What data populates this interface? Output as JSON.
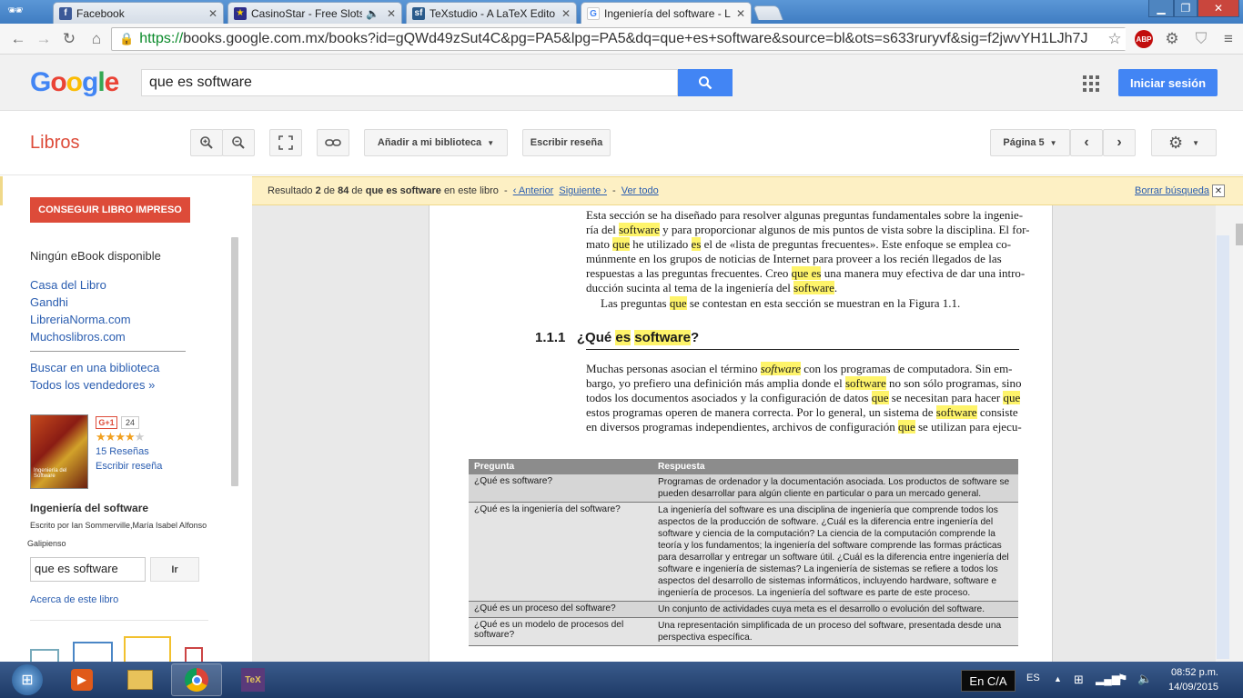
{
  "browser": {
    "tabs": [
      {
        "title": "Facebook",
        "favicon": "facebook-icon",
        "color": "#3b5998"
      },
      {
        "title": "CasinoStar - Free Slots",
        "favicon": "casino-icon",
        "color": "#2d2d8a"
      },
      {
        "title": "TeXstudio - A LaTeX Edito",
        "favicon": "texstudio-icon",
        "color": "#2a5a8a"
      },
      {
        "title": "Ingeniería del software - L",
        "favicon": "google-icon",
        "color": "#4285f4"
      }
    ],
    "url_https": "https://",
    "url_rest": "books.google.com.mx/books?id=gQWd49zSut4C&pg=PA5&lpg=PA5&dq=que+es+software&source=bl&ots=s633ruryvf&sig=f2jwvYH1LJh7J",
    "extension_abp": "ABP"
  },
  "google": {
    "logo": "Google",
    "query": "que es software",
    "signin": "Iniciar sesión"
  },
  "books_bar": {
    "section": "Libros",
    "add_library": "Añadir a mi biblioteca",
    "write_review": "Escribir reseña",
    "page": "Página 5"
  },
  "sidebar": {
    "buy_print": "CONSEGUIR LIBRO IMPRESO",
    "no_ebook": "Ningún eBook disponible",
    "stores": [
      "Casa del Libro",
      "Gandhi",
      "LibreriaNorma.com",
      "Muchoslibros.com"
    ],
    "find_library": "Buscar en una biblioteca",
    "all_sellers": "Todos los vendedores »",
    "gplus": "G+1",
    "gplus_count": "24",
    "rating": 4,
    "reviews": "15 Reseñas",
    "write_review": "Escribir reseña",
    "cover_text": "Ingeniería del Software",
    "book_title": "Ingeniería del software",
    "authors_line1": "Escrito por Ian Sommerville,María Isabel Alfonso",
    "authors_line2": "Galipienso",
    "search_value": "que es software",
    "go": "Ir",
    "about": "Acerca de este libro"
  },
  "result_bar": {
    "prefix": "Resultado",
    "num": "2",
    "of": "de",
    "total": "84",
    "de": "de",
    "query": "que es software",
    "suffix": "en este libro",
    "prev": "‹ Anterior",
    "next": "Siguiente ›",
    "all": "Ver todo",
    "clear": "Borrar búsqueda"
  },
  "page": {
    "section_num": "1.1.1",
    "section_title_pre": "¿Qué",
    "section_title_es": "es",
    "section_title_sw": "software",
    "section_title_end": "?",
    "table_head": [
      "Pregunta",
      "Respuesta"
    ],
    "table_rows": [
      {
        "q": "¿Qué es software?",
        "a": "Programas de ordenador y la documentación asociada. Los productos de software se pueden desarrollar para algún cliente en particular o para un mercado general."
      },
      {
        "q": "¿Qué es la ingeniería del software?",
        "a": "La ingeniería del software es una disciplina de ingeniería que comprende todos los aspectos de la producción de software. ¿Cuál es la diferencia entre ingeniería del software y ciencia de la computación? La ciencia de la computación comprende la teoría y los fundamentos; la ingeniería del software comprende las formas prácticas para desarrollar y entregar un software útil. ¿Cuál es la diferencia entre ingeniería del software e ingeniería de sistemas? La ingeniería de sistemas se refiere a todos los aspectos del desarrollo de sistemas informáticos, incluyendo hardware, software e ingeniería de procesos. La ingeniería del software es parte de este proceso."
      },
      {
        "q": "¿Qué es un proceso del software?",
        "a": "Un conjunto de actividades cuya meta es el desarrollo o evolución del software."
      },
      {
        "q": "¿Qué es un modelo de procesos del software?",
        "a": "Una representación simplificada de un proceso del software, presentada desde una perspectiva específica."
      }
    ]
  },
  "taskbar": {
    "lang": "En C/A",
    "es": "ES",
    "time": "08:52 p.m.",
    "date": "14/09/2015"
  }
}
